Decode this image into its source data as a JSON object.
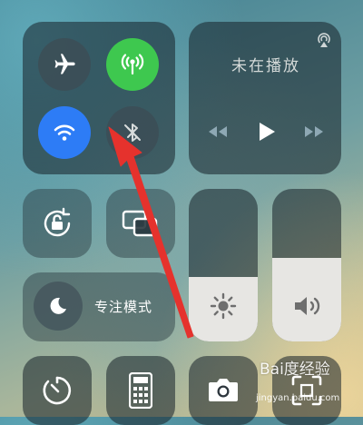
{
  "connectivity": {
    "airplane_mode": {
      "icon": "airplane-icon",
      "on": false
    },
    "cellular_data": {
      "icon": "cellular-antenna-icon",
      "on": true,
      "color": "#3ec84f"
    },
    "wifi": {
      "icon": "wifi-icon",
      "on": true,
      "color": "#2d7cf6"
    },
    "bluetooth": {
      "icon": "bluetooth-off-icon",
      "on": false
    }
  },
  "media": {
    "status": "未在播放",
    "airplay_icon": "airplay-icon",
    "controls": [
      "rewind-icon",
      "play-icon",
      "fast-forward-icon"
    ]
  },
  "controls": {
    "orientation_lock_icon": "rotation-lock-icon",
    "screen_mirroring_icon": "screen-mirroring-icon",
    "focus": {
      "label": "专注模式",
      "icon": "moon-icon"
    },
    "brightness_level": 0.42,
    "volume_level": 0.55
  },
  "bottom_row": [
    "timer-icon",
    "calculator-icon",
    "camera-icon",
    "qr-scanner-icon"
  ],
  "watermark": {
    "text": "Bai度经验",
    "url": "jingyan.baidu.com"
  },
  "annotation": {
    "arrow_color": "#e5322d"
  }
}
